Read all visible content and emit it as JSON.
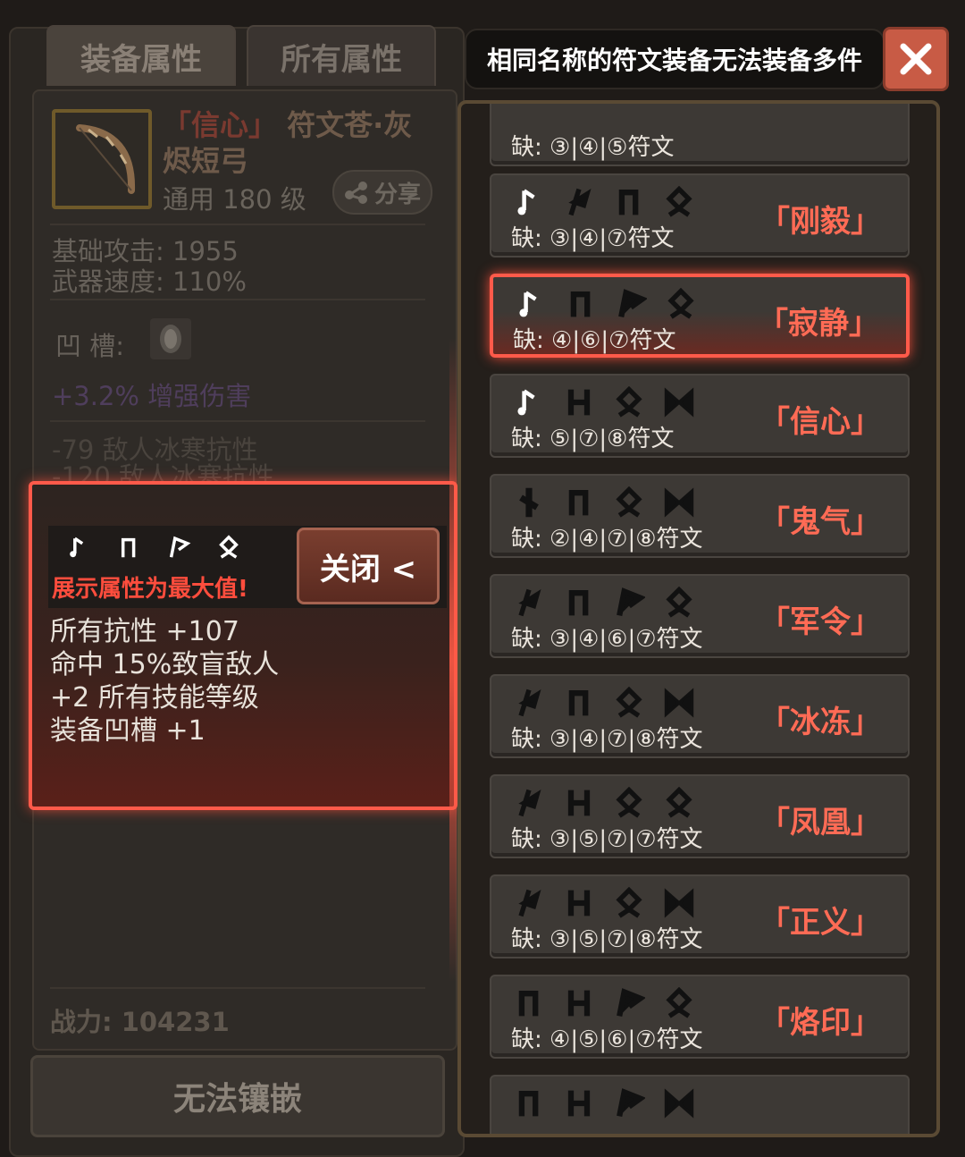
{
  "tabs": {
    "equip": "装备属性",
    "all": "所有属性"
  },
  "item": {
    "name_quote": "「信心」",
    "name_rest": "符文苍·灰烬短弓",
    "sub": "通用 180 级",
    "share": "分享",
    "base_attack": "基础攻击:  1955",
    "weapon_speed": "武器速度:  110%",
    "socket_label": "凹   槽:",
    "bonus": "+3.2% 增强伤害",
    "faded1": "-79 敌人冰寒抗性",
    "faded2": "-120 敌人冰寒抗性",
    "power": "战力: 104231",
    "inlay": "无法镶嵌"
  },
  "popup": {
    "max_text": "展示属性为最大值!",
    "close": "关闭 <",
    "stats": [
      "所有抗性 +107",
      "命中 15%致盲敌人",
      "+2 所有技能等级",
      "装备凹槽 +1"
    ]
  },
  "notice": "相同名称的符文装备无法装备多件",
  "runewords": [
    {
      "name": "",
      "missing": "缺: ③|④|⑤符文",
      "runes": []
    },
    {
      "name": "「刚毅」",
      "missing": "缺: ③|④|⑦符文",
      "runes": [
        "note",
        "flag",
        "gate",
        "knot"
      ]
    },
    {
      "name": "「寂静」",
      "missing": "缺: ④|⑥|⑦符文",
      "runes": [
        "note",
        "gate",
        "banner",
        "knot"
      ]
    },
    {
      "name": "「信心」",
      "missing": "缺: ⑤|⑦|⑧符文",
      "runes": [
        "note",
        "h",
        "knot",
        "bowtie"
      ]
    },
    {
      "name": "「鬼气」",
      "missing": "缺: ②|④|⑦|⑧符文",
      "runes": [
        "cross",
        "gate",
        "knot",
        "bowtie"
      ]
    },
    {
      "name": "「军令」",
      "missing": "缺: ③|④|⑥|⑦符文",
      "runes": [
        "flag",
        "gate",
        "banner",
        "knot"
      ]
    },
    {
      "name": "「冰冻」",
      "missing": "缺: ③|④|⑦|⑧符文",
      "runes": [
        "flag",
        "gate",
        "knot",
        "bowtie"
      ]
    },
    {
      "name": "「凤凰」",
      "missing": "缺: ③|⑤|⑦|⑦符文",
      "runes": [
        "flag",
        "h",
        "knot",
        "knot"
      ]
    },
    {
      "name": "「正义」",
      "missing": "缺: ③|⑤|⑦|⑧符文",
      "runes": [
        "flag",
        "h",
        "knot",
        "bowtie"
      ]
    },
    {
      "name": "「烙印」",
      "missing": "缺: ④|⑤|⑥|⑦符文",
      "runes": [
        "gate",
        "h",
        "banner",
        "knot"
      ]
    },
    {
      "name": "",
      "missing": "",
      "runes": [
        "gate",
        "h",
        "banner",
        "bowtie"
      ]
    }
  ],
  "colors": {
    "accent_red": "#ff5a4a",
    "name_red": "#ff6b55"
  },
  "icons": {
    "close": "close-x-icon",
    "share": "share-icon",
    "bow": "bow-icon",
    "socket": "empty-socket-icon"
  }
}
